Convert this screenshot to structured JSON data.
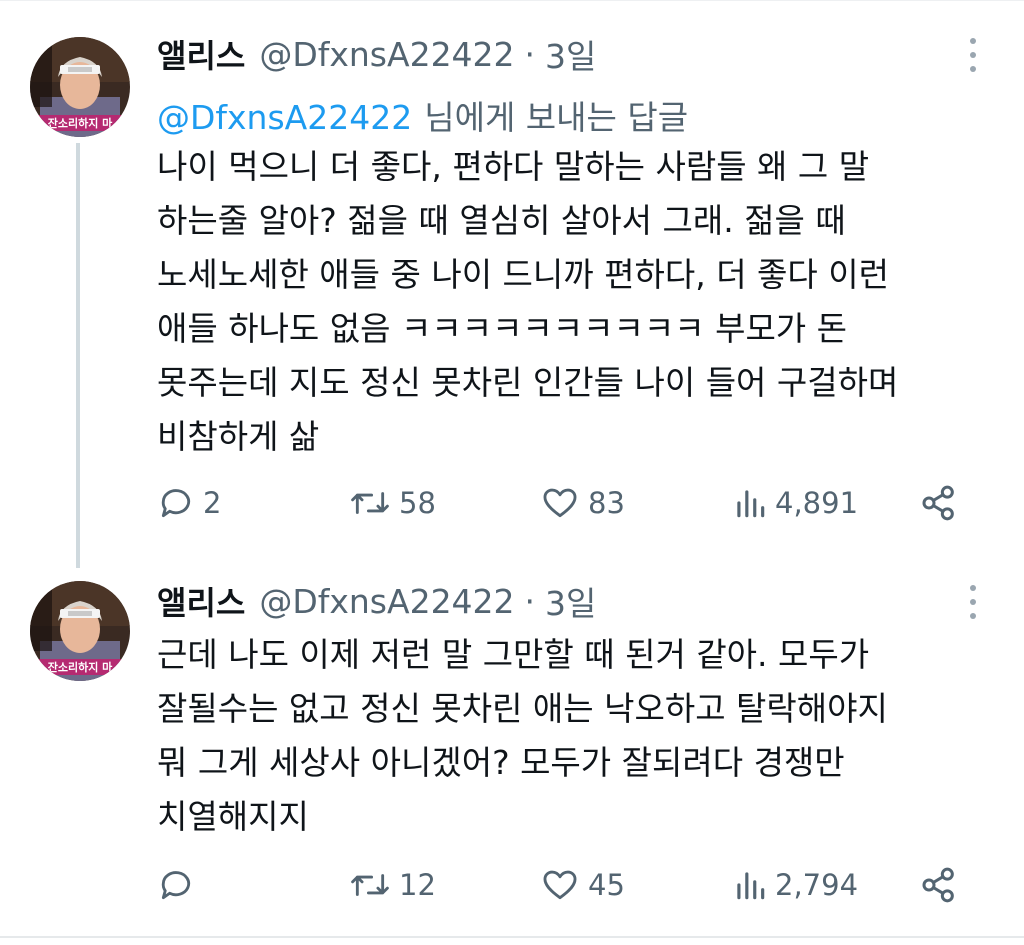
{
  "tweets": [
    {
      "display_name": "앨리스",
      "handle": "@DfxnsA22422",
      "separator": "·",
      "time": "3일",
      "reply_to": {
        "mention": "@DfxnsA22422",
        "suffix": "님에게 보내는 답글"
      },
      "lines": [
        "나이 먹으니 더 좋다, 편하다 말하는 사람들 왜 그 말",
        "하는줄 알아? 젊을 때 열심히 살아서 그래. 젊을 때",
        "노세노세한 애들 중 나이 드니까 편하다, 더 좋다 이런",
        "애들 하나도 없음 ㅋㅋㅋㅋㅋㅋㅋㅋㅋㅋ 부모가 돈",
        "못주는데 지도 정신 못차린 인간들 나이 들어 구걸하며",
        "비참하게 삶"
      ],
      "replies": "2",
      "retweets": "58",
      "likes": "83",
      "views": "4,891"
    },
    {
      "display_name": "앨리스",
      "handle": "@DfxnsA22422",
      "separator": "·",
      "time": "3일",
      "lines": [
        "근데 나도 이제 저런 말 그만할 때 된거 같아. 모두가",
        "잘될수는 없고 정신 못차린 애는 낙오하고 탈락해야지",
        "뭐 그게 세상사 아니겠어? 모두가 잘되려다 경쟁만",
        "치열해지지"
      ],
      "replies": "",
      "retweets": "12",
      "likes": "45",
      "views": "2,794"
    }
  ],
  "avatar": {
    "caption": "잔소리하지 마"
  },
  "icons": [
    "reply-icon",
    "retweet-icon",
    "like-icon",
    "views-icon",
    "share-icon",
    "more-icon"
  ],
  "colors": {
    "text": "#0f1419",
    "muted": "#536471",
    "link": "#1d9bf0",
    "thread": "#cfd9de"
  }
}
